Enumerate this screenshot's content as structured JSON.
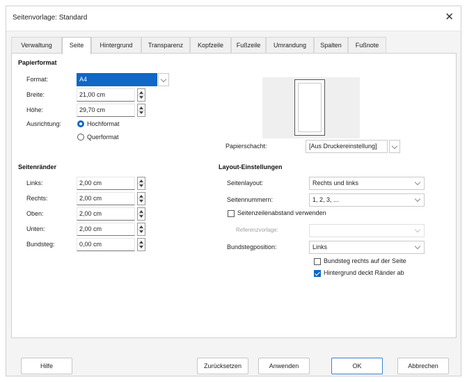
{
  "window": {
    "title": "Seitenvorlage: Standard",
    "close_glyph": "✕"
  },
  "tabs": [
    {
      "label": "Verwaltung"
    },
    {
      "label": "Seite"
    },
    {
      "label": "Hintergrund"
    },
    {
      "label": "Transparenz"
    },
    {
      "label": "Kopfzeile"
    },
    {
      "label": "Fußzeile"
    },
    {
      "label": "Umrandung"
    },
    {
      "label": "Spalten"
    },
    {
      "label": "Fußnote"
    }
  ],
  "active_tab": "Seite",
  "paper": {
    "heading": "Papierformat",
    "format_label": "Format:",
    "format_value": "A4",
    "width_label": "Breite:",
    "width_value": "21,00 cm",
    "height_label": "Höhe:",
    "height_value": "29,70 cm",
    "orientation_label": "Ausrichtung:",
    "portrait_label": "Hochformat",
    "landscape_label": "Querformat",
    "orientation_selected": "Hochformat",
    "tray_label": "Papierschacht:",
    "tray_value": "[Aus Druckereinstellung]"
  },
  "margins": {
    "heading": "Seitenränder",
    "left_label": "Links:",
    "left_value": "2,00 cm",
    "right_label": "Rechts:",
    "right_value": "2,00 cm",
    "top_label": "Oben:",
    "top_value": "2,00 cm",
    "bottom_label": "Unten:",
    "bottom_value": "2,00 cm",
    "gutter_label": "Bundsteg:",
    "gutter_value": "0,00 cm"
  },
  "layout": {
    "heading": "Layout-Einstellungen",
    "page_layout_label": "Seitenlayout:",
    "page_layout_value": "Rechts und links",
    "page_numbers_label": "Seitennummern:",
    "page_numbers_value": "1, 2, 3, ...",
    "register_true_label": "Seitenzeilenabstand verwenden",
    "register_true_checked": false,
    "reference_style_label": "Referenzvorlage:",
    "reference_style_value": "",
    "gutter_position_label": "Bundstegposition:",
    "gutter_position_value": "Links",
    "gutter_right_label": "Bundsteg rechts auf der Seite",
    "gutter_right_checked": false,
    "background_covers_label": "Hintergrund deckt Ränder ab",
    "background_covers_checked": true
  },
  "buttons": {
    "help": "Hilfe",
    "reset": "Zurücksetzen",
    "apply": "Anwenden",
    "ok": "OK",
    "cancel": "Abbrechen"
  },
  "colors": {
    "accent": "#0f67c6"
  }
}
